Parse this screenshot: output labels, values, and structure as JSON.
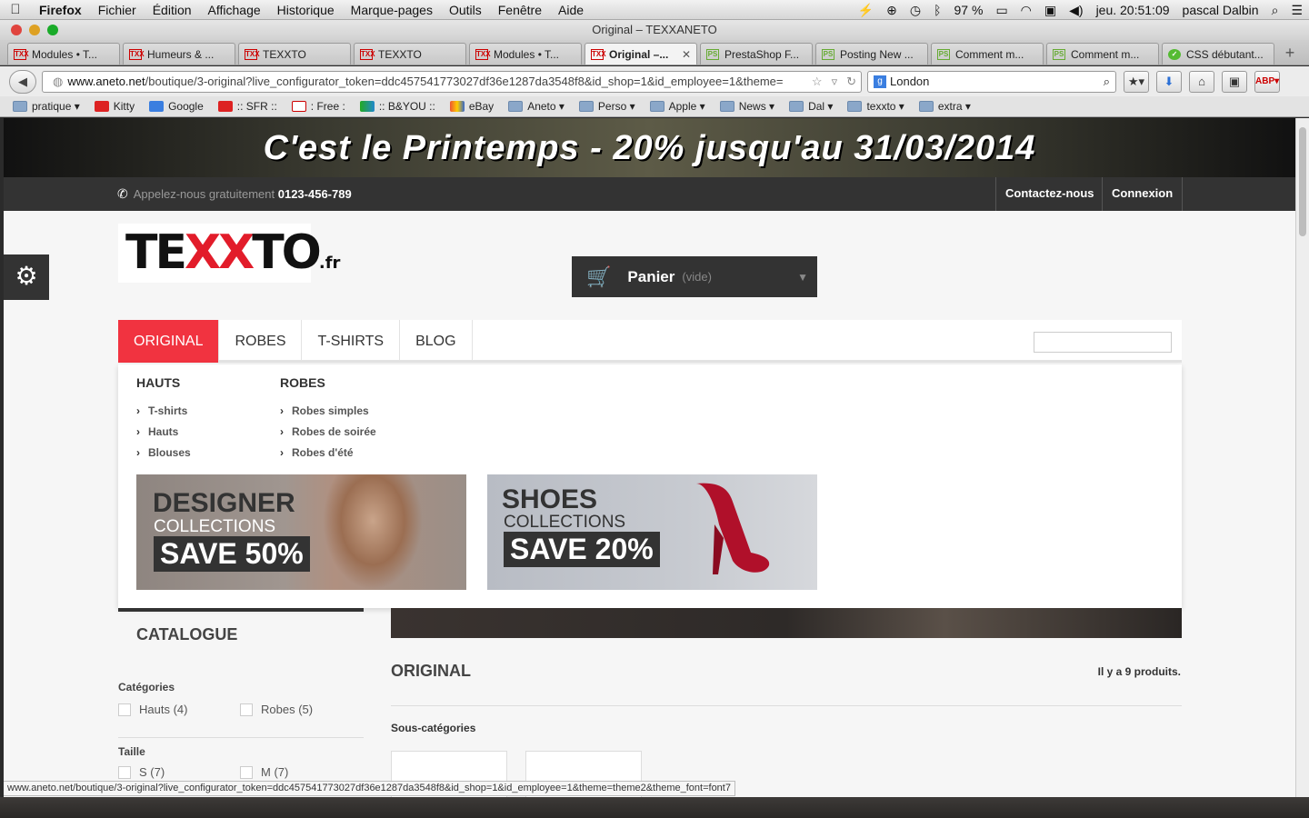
{
  "menubar": {
    "app": "Firefox",
    "items": [
      "Fichier",
      "Édition",
      "Affichage",
      "Historique",
      "Marque-pages",
      "Outils",
      "Fenêtre",
      "Aide"
    ],
    "battery": "97 %",
    "clock": "jeu. 20:51:09",
    "user": "pascal Dalbin"
  },
  "window": {
    "title": "Original – TEXXANETO"
  },
  "tabs": [
    {
      "label": "Modules • T...",
      "favicon": "TXX"
    },
    {
      "label": "Humeurs & ...",
      "favicon": "TXX"
    },
    {
      "label": "TEXXTO",
      "favicon": "TXX"
    },
    {
      "label": "TEXXTO",
      "favicon": "TXX"
    },
    {
      "label": "Modules • T...",
      "favicon": "TXX"
    },
    {
      "label": "Original –...",
      "favicon": "TXX",
      "active": true
    },
    {
      "label": "PrestaShop F...",
      "favicon": "PS"
    },
    {
      "label": "Posting New ...",
      "favicon": "PS"
    },
    {
      "label": "Comment m...",
      "favicon": "PS"
    },
    {
      "label": "Comment m...",
      "favicon": "PS"
    },
    {
      "label": "CSS débutant...",
      "favicon": "✓"
    }
  ],
  "nav": {
    "url_host": "www.aneto.net",
    "url_rest": "/boutique/3-original?live_configurator_token=ddc457541773027df36e1287da3548f8&id_shop=1&id_employee=1&theme=",
    "search_value": "London"
  },
  "bookmarks": [
    {
      "label": "pratique",
      "icon": "folder-icon",
      "dropdown": true
    },
    {
      "label": "Kitty",
      "icon": "youtube-icon"
    },
    {
      "label": "Google",
      "icon": "google-icon"
    },
    {
      "label": ":: SFR ::",
      "icon": "sfr-icon"
    },
    {
      "label": ": Free :",
      "icon": "free-icon"
    },
    {
      "label": ":: B&YOU ::",
      "icon": "byou-icon"
    },
    {
      "label": "eBay",
      "icon": "ebay-icon"
    },
    {
      "label": "Aneto",
      "icon": "folder-icon",
      "dropdown": true
    },
    {
      "label": "Perso",
      "icon": "folder-icon",
      "dropdown": true
    },
    {
      "label": "Apple",
      "icon": "folder-icon",
      "dropdown": true
    },
    {
      "label": "News",
      "icon": "folder-icon",
      "dropdown": true
    },
    {
      "label": "Dal",
      "icon": "folder-icon",
      "dropdown": true
    },
    {
      "label": "texxto",
      "icon": "folder-icon",
      "dropdown": true
    },
    {
      "label": "extra",
      "icon": "folder-icon",
      "dropdown": true
    }
  ],
  "site": {
    "promo": "C'est le Printemps  - 20% jusqu'au 31/03/2014",
    "call_prefix": "Appelez-nous gratuitement",
    "phone": "0123-456-789",
    "contact": "Contactez-nous",
    "login": "Connexion",
    "logo": {
      "a": "TE",
      "b": "XX",
      "c": "TO",
      "d": ".fr"
    },
    "cart": {
      "label": "Panier",
      "state": "(vide)"
    },
    "menu": [
      "ORIGINAL",
      "ROBES",
      "T-SHIRTS",
      "BLOG"
    ],
    "mega": {
      "col1": {
        "title": "HAUTS",
        "items": [
          "T-shirts",
          "Hauts",
          "Blouses"
        ]
      },
      "col2": {
        "title": "ROBES",
        "items": [
          "Robes simples",
          "Robes de soirée",
          "Robes d'été"
        ]
      },
      "banner1": {
        "line1": "DESIGNER",
        "line2": "COLLECTIONS",
        "line3": "SAVE 50%"
      },
      "banner2": {
        "line1": "SHOES",
        "line2": "COLLECTIONS",
        "line3": "SAVE 20%"
      }
    },
    "catalogue": "CATALOGUE",
    "filters": {
      "categories": "Catégories",
      "cat_opts": [
        "Hauts (4)",
        "Robes (5)"
      ],
      "size": "Taille",
      "size_opts": [
        "S (7)",
        "M (7)"
      ]
    },
    "category_name": "ORIGINAL",
    "product_count": "Il y a 9 produits.",
    "subcategories": "Sous-catégories"
  },
  "status_url": "www.aneto.net/boutique/3-original?live_configurator_token=ddc457541773027df36e1287da3548f8&id_shop=1&id_employee=1&theme=theme2&theme_font=font7",
  "colors": {
    "accent": "#f13340",
    "dark": "#333333"
  }
}
